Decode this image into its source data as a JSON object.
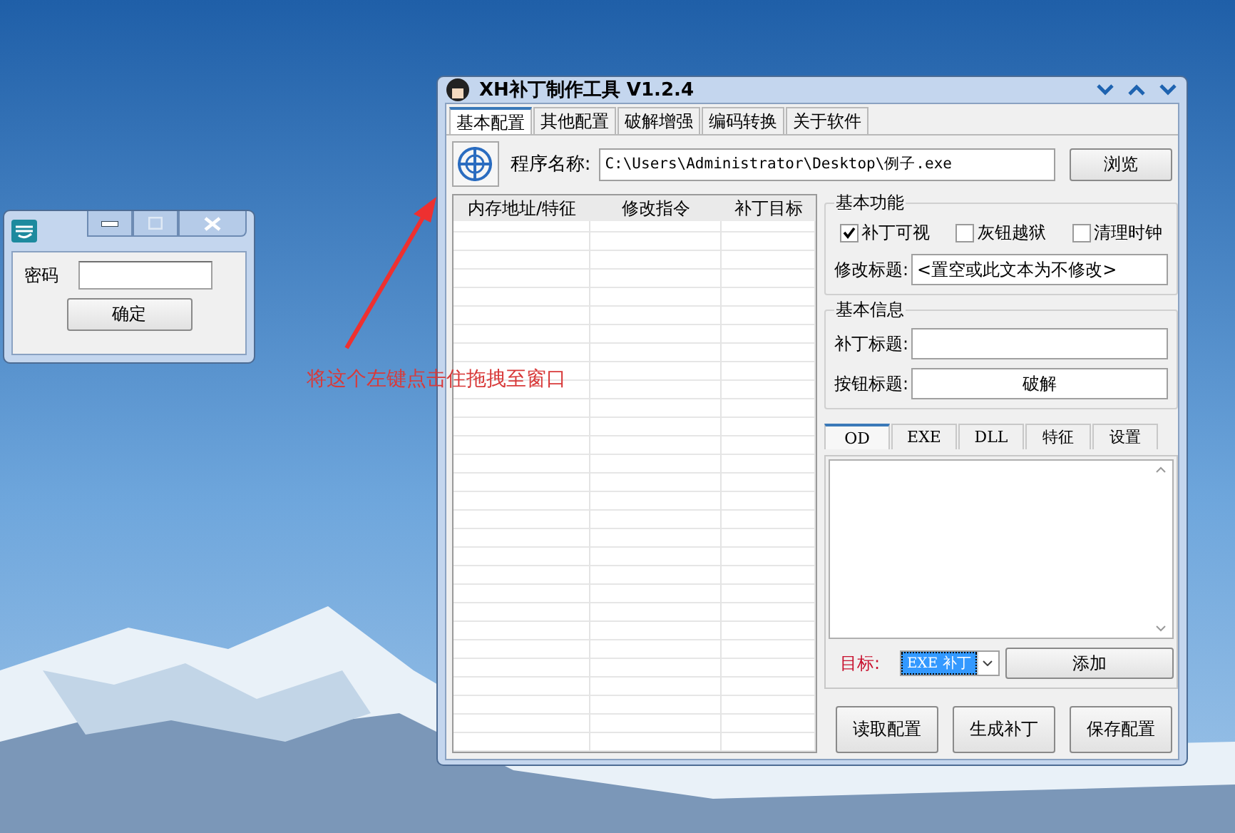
{
  "login_window": {
    "password_label": "密码",
    "ok_button": "确定"
  },
  "annotation": {
    "text": "将这个左键点击住拖拽至窗口"
  },
  "main_window": {
    "title": "XH补丁制作工具 V1.2.4",
    "tabs": [
      {
        "label": "基本配置",
        "selected": true
      },
      {
        "label": "其他配置",
        "selected": false
      },
      {
        "label": "破解增强",
        "selected": false
      },
      {
        "label": "编码转换",
        "selected": false
      },
      {
        "label": "关于软件",
        "selected": false
      }
    ],
    "program_label": "程序名称:",
    "program_path": "C:\\Users\\Administrator\\Desktop\\例子.exe",
    "browse_button": "浏览",
    "list_columns": [
      "内存地址/特征",
      "修改指令",
      "补丁目标"
    ],
    "basic_functions": {
      "title": "基本功能",
      "checkboxes": [
        {
          "label": "补丁可视",
          "checked": true
        },
        {
          "label": "灰钮越狱",
          "checked": false
        },
        {
          "label": "清理时钟",
          "checked": false
        }
      ],
      "modify_title_label": "修改标题:",
      "modify_title_value": "<置空或此文本为不修改>"
    },
    "basic_info": {
      "title": "基本信息",
      "patch_title_label": "补丁标题:",
      "button_title_label": "按钮标题:",
      "button_title_value": "破解"
    },
    "inner_tabs": [
      {
        "label": "OD",
        "selected": true
      },
      {
        "label": "EXE",
        "selected": false
      },
      {
        "label": "DLL",
        "selected": false
      },
      {
        "label": "特征",
        "selected": false
      },
      {
        "label": "设置",
        "selected": false
      }
    ],
    "target_label": "目标:",
    "target_value": "EXE 补丁",
    "add_button": "添加",
    "bottom_buttons": [
      "读取配置",
      "生成补丁",
      "保存配置"
    ]
  }
}
